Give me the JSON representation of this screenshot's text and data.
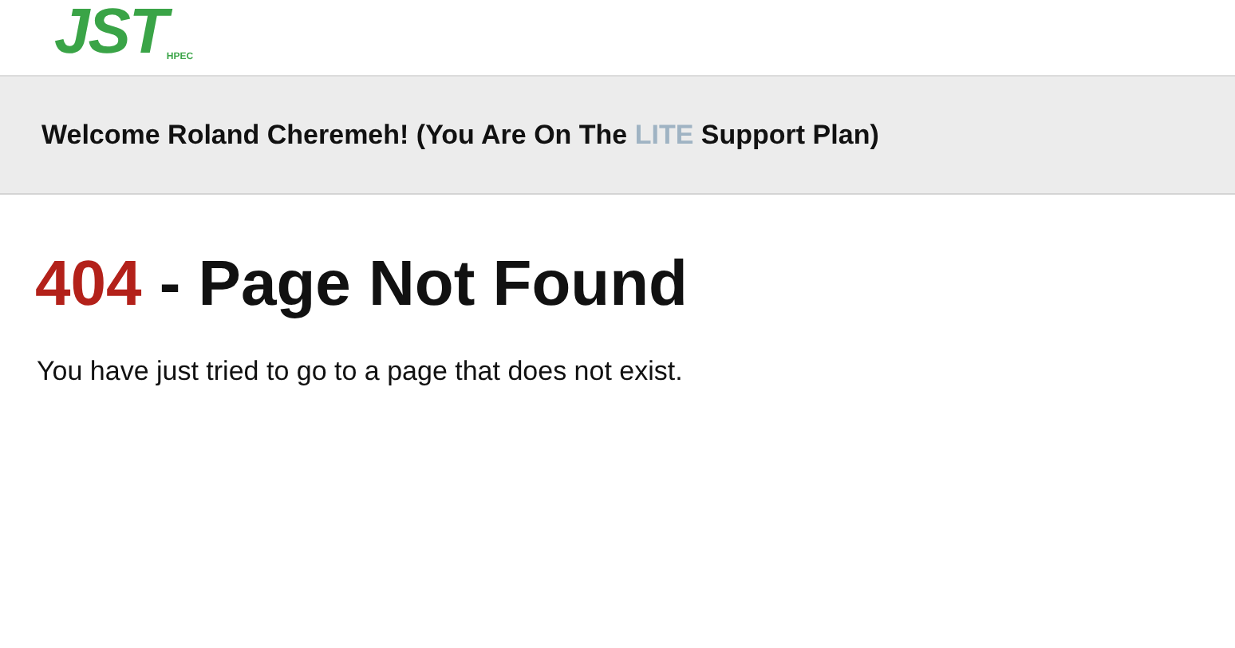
{
  "logo": {
    "name": "JST",
    "sub": "HPEC"
  },
  "welcome": {
    "before": "Welcome Roland Cheremeh! (You Are On The ",
    "plan": "LITE",
    "after": " Support Plan)"
  },
  "heading": {
    "code": "404",
    "text": " - Page Not Found"
  },
  "message": "You have just tried to go to a page that does not exist."
}
